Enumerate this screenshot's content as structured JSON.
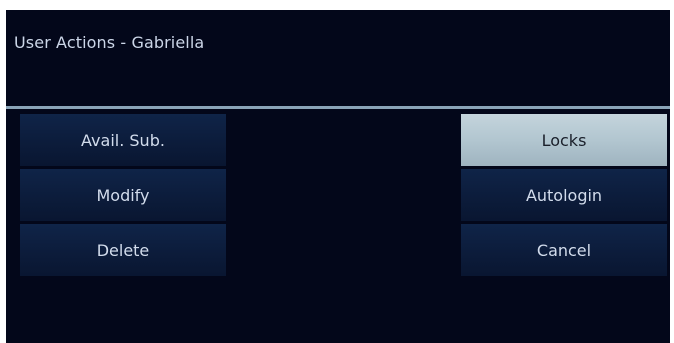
{
  "header": {
    "title": "User Actions - Gabriella"
  },
  "buttons": {
    "avail_sub": "Avail. Sub.",
    "modify": "Modify",
    "delete": "Delete",
    "locks": "Locks",
    "autologin": "Autologin",
    "cancel": "Cancel"
  },
  "state": {
    "selected_button": "Locks"
  },
  "colors": {
    "background": "#03071a",
    "button": "#0c1c3b",
    "button_active": "#b2c6d0",
    "divider": "#8aa4b8",
    "text": "#d2dcec"
  }
}
